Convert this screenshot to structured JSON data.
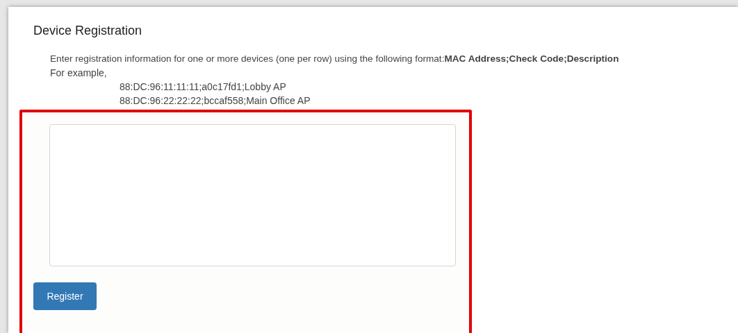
{
  "title": "Device Registration",
  "instructions": "Enter registration information for one or more devices (one per row) using the following format:**MAC Address;Check Code;Description**",
  "example_label": "For example,",
  "examples": [
    "88:DC:96:11:11:11;a0c17fd1;Lobby AP",
    "88:DC:96:22:22:22;bccaf558;Main Office AP"
  ],
  "register_button": "Register"
}
